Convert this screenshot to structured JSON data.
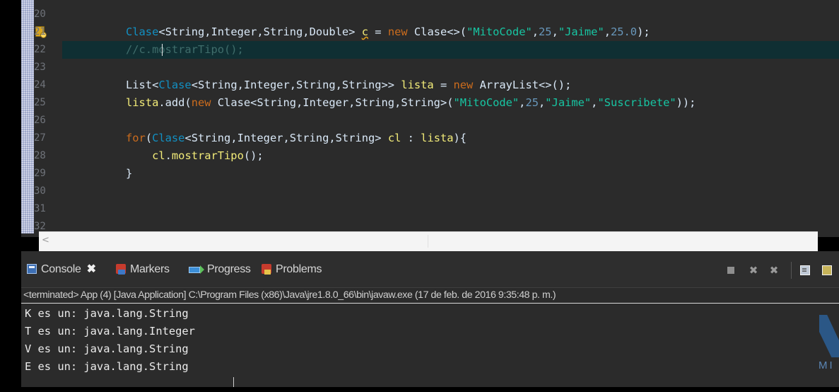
{
  "editor": {
    "line_numbers": [
      "20",
      "21",
      "22",
      "23",
      "24",
      "25",
      "26",
      "27",
      "28",
      "29",
      "30",
      "31",
      "32"
    ],
    "code_lines": [
      [
        {
          "t": "Clase",
          "c": "type"
        },
        {
          "t": "<",
          "c": "id"
        },
        {
          "t": "String",
          "c": "class"
        },
        {
          "t": ",",
          "c": "id"
        },
        {
          "t": "Integer",
          "c": "class"
        },
        {
          "t": ",",
          "c": "id"
        },
        {
          "t": "String",
          "c": "class"
        },
        {
          "t": ",",
          "c": "id"
        },
        {
          "t": "Double",
          "c": "class"
        },
        {
          "t": "> ",
          "c": "id"
        },
        {
          "t": "c",
          "c": "warn"
        },
        {
          "t": " = ",
          "c": "id"
        },
        {
          "t": "new",
          "c": "kw"
        },
        {
          "t": " ",
          "c": "id"
        },
        {
          "t": "Clase",
          "c": "class"
        },
        {
          "t": "<>(",
          "c": "id"
        },
        {
          "t": "\"MitoCode\"",
          "c": "str"
        },
        {
          "t": ",",
          "c": "id"
        },
        {
          "t": "25",
          "c": "num"
        },
        {
          "t": ",",
          "c": "id"
        },
        {
          "t": "\"Jaime\"",
          "c": "str"
        },
        {
          "t": ",",
          "c": "id"
        },
        {
          "t": "25.0",
          "c": "num"
        },
        {
          "t": ");",
          "c": "id"
        }
      ],
      [
        {
          "t": "//c.mostrarTipo();",
          "c": "comment"
        }
      ],
      [],
      [
        {
          "t": "List",
          "c": "class"
        },
        {
          "t": "<",
          "c": "id"
        },
        {
          "t": "Clase",
          "c": "type"
        },
        {
          "t": "<",
          "c": "id"
        },
        {
          "t": "String",
          "c": "class"
        },
        {
          "t": ",",
          "c": "id"
        },
        {
          "t": "Integer",
          "c": "class"
        },
        {
          "t": ",",
          "c": "id"
        },
        {
          "t": "String",
          "c": "class"
        },
        {
          "t": ",",
          "c": "id"
        },
        {
          "t": "String",
          "c": "class"
        },
        {
          "t": ">> ",
          "c": "id"
        },
        {
          "t": "lista",
          "c": "var"
        },
        {
          "t": " = ",
          "c": "id"
        },
        {
          "t": "new",
          "c": "kw"
        },
        {
          "t": " ",
          "c": "id"
        },
        {
          "t": "ArrayList",
          "c": "class"
        },
        {
          "t": "<>();",
          "c": "id"
        }
      ],
      [
        {
          "t": "lista",
          "c": "var"
        },
        {
          "t": ".add(",
          "c": "id"
        },
        {
          "t": "new",
          "c": "kw"
        },
        {
          "t": " ",
          "c": "id"
        },
        {
          "t": "Clase",
          "c": "class"
        },
        {
          "t": "<",
          "c": "id"
        },
        {
          "t": "String",
          "c": "class"
        },
        {
          "t": ",",
          "c": "id"
        },
        {
          "t": "Integer",
          "c": "class"
        },
        {
          "t": ",",
          "c": "id"
        },
        {
          "t": "String",
          "c": "class"
        },
        {
          "t": ",",
          "c": "id"
        },
        {
          "t": "String",
          "c": "class"
        },
        {
          "t": ">(",
          "c": "id"
        },
        {
          "t": "\"MitoCode\"",
          "c": "str"
        },
        {
          "t": ",",
          "c": "id"
        },
        {
          "t": "25",
          "c": "num"
        },
        {
          "t": ",",
          "c": "id"
        },
        {
          "t": "\"Jaime\"",
          "c": "str"
        },
        {
          "t": ",",
          "c": "id"
        },
        {
          "t": "\"Suscribete\"",
          "c": "str"
        },
        {
          "t": "));",
          "c": "id"
        }
      ],
      [],
      [
        {
          "t": "for",
          "c": "kw"
        },
        {
          "t": "(",
          "c": "id"
        },
        {
          "t": "Clase",
          "c": "type"
        },
        {
          "t": "<",
          "c": "id"
        },
        {
          "t": "String",
          "c": "class"
        },
        {
          "t": ",",
          "c": "id"
        },
        {
          "t": "Integer",
          "c": "class"
        },
        {
          "t": ",",
          "c": "id"
        },
        {
          "t": "String",
          "c": "class"
        },
        {
          "t": ",",
          "c": "id"
        },
        {
          "t": "String",
          "c": "class"
        },
        {
          "t": "> ",
          "c": "id"
        },
        {
          "t": "cl",
          "c": "var"
        },
        {
          "t": " : ",
          "c": "id"
        },
        {
          "t": "lista",
          "c": "var"
        },
        {
          "t": "){",
          "c": "id"
        }
      ],
      [
        {
          "t": "    ",
          "c": "id"
        },
        {
          "t": "cl",
          "c": "var"
        },
        {
          "t": ".",
          "c": "id"
        },
        {
          "t": "mostrarTipo",
          "c": "var"
        },
        {
          "t": "();",
          "c": "id"
        }
      ],
      [
        {
          "t": "}",
          "c": "id"
        }
      ]
    ],
    "code_line_first_index": 1,
    "colors": {
      "background": "#2b2b2b",
      "current_line": "#0f2f33",
      "keyword": "#cc6c1d",
      "string": "#17c6a3",
      "type": "#1290c3",
      "variable": "#f3ec79"
    }
  },
  "scrollbar": {
    "left_arrow": "<"
  },
  "console": {
    "tabs": [
      {
        "label": "Console",
        "icon": "console-icon",
        "active": true
      },
      {
        "label": "Markers",
        "icon": "markers-icon",
        "active": false
      },
      {
        "label": "Progress",
        "icon": "progress-icon",
        "active": false
      },
      {
        "label": "Problems",
        "icon": "problems-icon",
        "active": false
      }
    ],
    "close_glyph": "✖",
    "toolbar": [
      {
        "name": "terminate-button",
        "glyph": ""
      },
      {
        "name": "remove-launch-button",
        "glyph": "✖"
      },
      {
        "name": "remove-all-terminated-button",
        "glyph": "✖"
      },
      {
        "name": "clear-console-button",
        "glyph": ""
      },
      {
        "name": "scroll-lock-button",
        "glyph": ""
      }
    ],
    "status": "<terminated> App (4) [Java Application] C:\\Program Files (x86)\\Java\\jre1.8.0_66\\bin\\javaw.exe (17 de feb. de 2016 9:35:48 p. m.)",
    "output_lines": [
      "K es un: java.lang.String",
      "T es un: java.lang.Integer",
      "V es un: java.lang.String",
      "E es un: java.lang.String"
    ]
  },
  "watermark": {
    "text": "MI",
    "color": "#2c5f97"
  }
}
